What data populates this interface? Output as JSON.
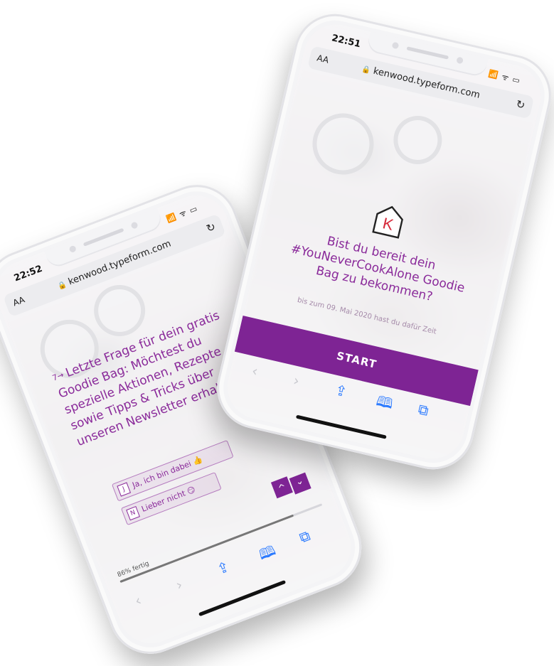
{
  "phone_left": {
    "status": {
      "time": "22:52",
      "signal_icons": "📶 ᯤ ▭"
    },
    "urlbar": {
      "aa_label": "AA",
      "url": "kenwood.typeform.com"
    },
    "question": {
      "number": "7→",
      "text": "Letzte Frage für dein gratis Goodie Bag: Möchtest du spezielle Aktionen, Rezepte sowie Tipps & Tricks über unseren Newsletter erhalten?"
    },
    "choices": [
      {
        "key": "J",
        "label": "Ja, ich bin dabei 👍"
      },
      {
        "key": "N",
        "label": "Lieber nicht 😏"
      }
    ],
    "progress": {
      "label": "86% fertig",
      "value": 0.86
    },
    "nav": {
      "up": "^",
      "down": "⌄"
    }
  },
  "phone_right": {
    "status": {
      "time": "22:51",
      "signal_icons": "📶 ᯤ ▭"
    },
    "urlbar": {
      "aa_label": "AA",
      "url": "kenwood.typeform.com"
    },
    "logo_letter": "K",
    "welcome": {
      "title": "Bist du bereit dein #YouNeverCookAlone Goodie Bag zu bekommen?",
      "subtitle": "bis zum 09. Mai 2020 hast du dafür Zeit"
    },
    "start_label": "START"
  },
  "colors": {
    "accent_purple": "#8a2a9a",
    "button_purple": "#7e2494",
    "safari_blue": "#2d7bff",
    "logo_red": "#d6293a"
  },
  "icons": {
    "back": "‹",
    "forward": "›",
    "share": "⇪",
    "bookmarks": "🕮",
    "tabs": "⧉",
    "lock": "🔒",
    "reload": "↻"
  }
}
